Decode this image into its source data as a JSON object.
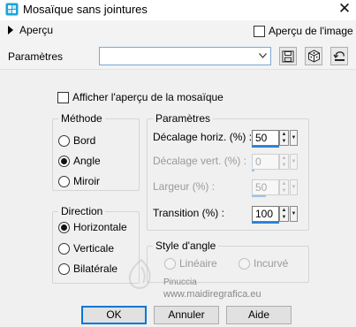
{
  "window": {
    "title": "Mosaïque sans jointures",
    "close_glyph": "✕",
    "icon": "mosaic-app-icon"
  },
  "header": {
    "preview_toggle_label": "Aperçu",
    "preview_image_label": "Aperçu de l'image",
    "preview_image_checked": false,
    "params_label": "Paramètres",
    "preset_value": "",
    "tools": [
      "save-preset-icon",
      "randomize-icon",
      "reset-icon"
    ]
  },
  "show_preview": {
    "label": "Afficher l'aperçu de la mosaïque",
    "checked": false
  },
  "method": {
    "title": "Méthode",
    "options": [
      {
        "label": "Bord",
        "selected": false
      },
      {
        "label": "Angle",
        "selected": true
      },
      {
        "label": "Miroir",
        "selected": false
      }
    ]
  },
  "params": {
    "title": "Paramètres",
    "fields": [
      {
        "label": "Décalage horiz. (%) :",
        "value": "50",
        "enabled": true
      },
      {
        "label": "Décalage vert. (%) :",
        "value": "0",
        "enabled": false
      },
      {
        "label": "Largeur (%) :",
        "value": "50",
        "enabled": false
      },
      {
        "label": "Transition (%) :",
        "value": "100",
        "enabled": true
      }
    ]
  },
  "direction": {
    "title": "Direction",
    "options": [
      {
        "label": "Horizontale",
        "selected": true
      },
      {
        "label": "Verticale",
        "selected": false
      },
      {
        "label": "Bilatérale",
        "selected": false
      }
    ]
  },
  "corner_style": {
    "title": "Style d'angle",
    "options": [
      {
        "label": "Linéaire",
        "selected": true,
        "enabled": false
      },
      {
        "label": "Incurvé",
        "selected": false,
        "enabled": false
      }
    ]
  },
  "watermark": {
    "line1": "Pinuccia",
    "line2": "www.maidiregrafica.eu"
  },
  "buttons": {
    "ok": "OK",
    "cancel": "Annuler",
    "help": "Aide"
  },
  "colors": {
    "accent": "#0078d7",
    "spin_underline": "#2f7fd6",
    "app_icon": "#1aa5d8"
  }
}
